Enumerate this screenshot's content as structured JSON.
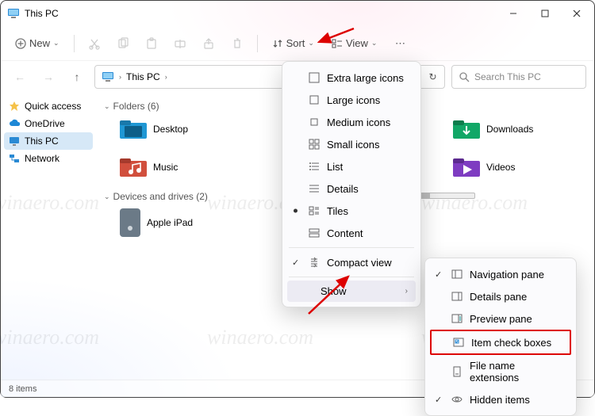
{
  "window": {
    "title": "This PC"
  },
  "toolbar": {
    "new_label": "New",
    "sort_label": "Sort",
    "view_label": "View"
  },
  "address": {
    "location": "This PC",
    "separator": "›"
  },
  "search": {
    "placeholder": "Search This PC"
  },
  "sidebar": {
    "items": [
      {
        "label": "Quick access"
      },
      {
        "label": "OneDrive"
      },
      {
        "label": "This PC"
      },
      {
        "label": "Network"
      }
    ]
  },
  "content": {
    "folders_header": "Folders (6)",
    "folders": [
      {
        "label": "Desktop",
        "color": "#1f97d4"
      },
      {
        "label": "Downloads",
        "color": "#12a767"
      },
      {
        "label": "Music",
        "color": "#d14f3d"
      },
      {
        "label": "Videos",
        "color": "#7e3cc1"
      }
    ],
    "drives_header": "Devices and drives (2)",
    "drives": [
      {
        "label": "Apple iPad"
      }
    ]
  },
  "view_menu": {
    "items": [
      {
        "label": "Extra large icons",
        "icon": "xl"
      },
      {
        "label": "Large icons",
        "icon": "lg"
      },
      {
        "label": "Medium icons",
        "icon": "md"
      },
      {
        "label": "Small icons",
        "icon": "sm"
      },
      {
        "label": "List",
        "icon": "list"
      },
      {
        "label": "Details",
        "icon": "details"
      },
      {
        "label": "Tiles",
        "icon": "tiles",
        "bullet": true
      },
      {
        "label": "Content",
        "icon": "content"
      }
    ],
    "compact_label": "Compact view",
    "show_label": "Show"
  },
  "show_submenu": {
    "items": [
      {
        "label": "Navigation pane",
        "checked": true
      },
      {
        "label": "Details pane",
        "checked": false
      },
      {
        "label": "Preview pane",
        "checked": false
      },
      {
        "label": "Item check boxes",
        "checked": false,
        "highlight": true
      },
      {
        "label": "File name extensions",
        "checked": false
      },
      {
        "label": "Hidden items",
        "checked": true
      }
    ]
  },
  "status": {
    "text": "8 items"
  },
  "watermark": "winaero.com"
}
